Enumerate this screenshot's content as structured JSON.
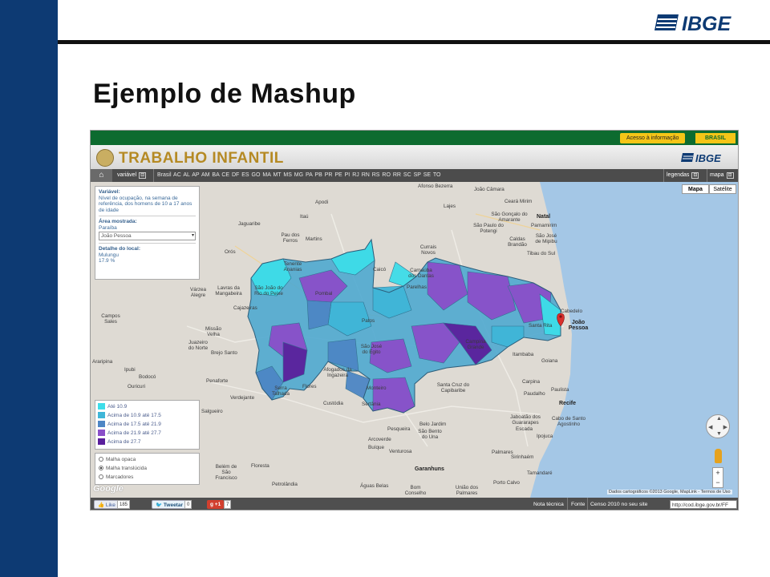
{
  "slide": {
    "title": "Ejemplo de Mashup",
    "logo_text": "IBGE"
  },
  "gov_bar": {
    "acesso": "Acesso à informação",
    "brasil": "BRASIL"
  },
  "app": {
    "title": "TRABALHO INFANTIL",
    "brand": "IBGE",
    "nav": {
      "variable": "variável",
      "states": "Brasil AC AL AP AM BA CE DF ES GO MA MT MS MG PA PB PR PE PI RJ RN RS RO RR SC SP SE TO",
      "legend": "legendas",
      "map": "mapa"
    }
  },
  "map_type": {
    "map": "Mapa",
    "satellite": "Satélite"
  },
  "info": {
    "variable_head": "Variável:",
    "variable_text": "Nível de ocupação, na semana de referência, dos homens de 10 a 17 anos de idade",
    "area_head": "Área mostrada:",
    "area_value": "Paraíba",
    "area_select": "João Pessoa",
    "detail_head": "Detalhe do local:",
    "detail_place": "Mulungu",
    "detail_value": "17.9 %"
  },
  "legend": [
    {
      "label": "Até 10.9",
      "color": "#3ddde9"
    },
    {
      "label": "Acima de 10.9 até 17.5",
      "color": "#3fb6d8"
    },
    {
      "label": "Acima de 17.5 até 21.9",
      "color": "#4d86c5"
    },
    {
      "label": "Acima de 21.9 até 27.7",
      "color": "#8a4fc9"
    },
    {
      "label": "Acima de 27.7",
      "color": "#5a1f9c"
    }
  ],
  "modes": [
    {
      "label": "Malha opaca",
      "selected": false
    },
    {
      "label": "Malha translúcida",
      "selected": true
    },
    {
      "label": "Marcadores",
      "selected": false
    }
  ],
  "places": [
    "Afonso Bezerra",
    "João Câmara",
    "Ceará Mirim",
    "Apodi",
    "Lajes",
    "São Gonçalo do Amarante",
    "Natal",
    "Parnamirim",
    "São Paulo do Potengi",
    "Caldas Brandão",
    "São José de Mipibu",
    "Tibau do Sul",
    "Jaguaribe",
    "Itaú",
    "Pau dos Ferros",
    "Martins",
    "Currais Novos",
    "Orós",
    "Tenente Ananias",
    "São João do Rio do Peixe",
    "Caicó",
    "Carnaúba dos Dantas",
    "Parelhas",
    "Várzea Alegre",
    "Lavras da Mangabeira",
    "Cajazeiras",
    "Pombal",
    "Campos Sales",
    "Missão Velha",
    "Juazeiro do Norte",
    "Brejo Santo",
    "Araripina",
    "Ipubi",
    "Bodocó",
    "Ouricuri",
    "Penaforte",
    "Verdejante",
    "Salgueiro",
    "Serra Talhada",
    "Flores",
    "Afogados da Ingazeira",
    "São José do Egito",
    "Monteiro",
    "Patos",
    "Campina Grande",
    "Santa Rita",
    "João Pessoa",
    "Cabedelo",
    "Itambaba",
    "Goiana",
    "Carpina",
    "Paudalho",
    "Paulista",
    "Recife",
    "Santa Cruz do Capibaribe",
    "Custódia",
    "Sertânia",
    "Jaboatão dos Guararapes",
    "Cabo de Santo Agostinho",
    "Escada",
    "Ipojuca",
    "Pesqueira",
    "Belo Jardim",
    "São Bento do Una",
    "Arcoverde",
    "Buíque",
    "Venturosa",
    "Palmares",
    "Garanhuns",
    "Belém de São Francisco",
    "Floresta",
    "Petrolândia",
    "Águas Belas",
    "Bom Conselho",
    "União dos Palmares",
    "Porto Calvo",
    "Sirinhaém",
    "Tamandaré"
  ],
  "credits": "Dados cartográficos ©2013 Google, MapLink - Termos de Uso",
  "google": "Google",
  "footer": {
    "like": "Like",
    "like_count": "185",
    "tweet": "Tweetar",
    "tweet_count": "0",
    "gplus": "+1",
    "gplus_count": "7",
    "nota": "Nota técnica",
    "fonte": "Fonte",
    "censo": "Censo 2010 no seu site",
    "url": "http://cod.ibge.gov.br/FF"
  }
}
